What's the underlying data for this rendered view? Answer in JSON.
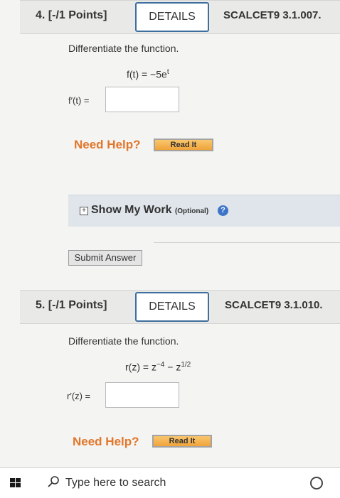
{
  "q4": {
    "number": "4. [-/1 Points]",
    "details_label": "DETAILS",
    "code": "SCALCET9 3.1.007.",
    "instruction": "Differentiate the function.",
    "func_lhs": "f(t) = −5e",
    "func_exp": "t",
    "answer_label": "f′(t) =",
    "answer_value": "",
    "need_help": "Need Help?",
    "read_it": "Read It"
  },
  "show_work": {
    "label": "Show My Work",
    "optional": "(Optional)"
  },
  "submit_label": "Submit Answer",
  "q5": {
    "number": "5. [-/1 Points]",
    "details_label": "DETAILS",
    "code": "SCALCET9 3.1.010.",
    "instruction": "Differentiate the function.",
    "func_base1": "r(z) = z",
    "func_exp1": "−4",
    "func_mid": " − z",
    "func_exp2": "1/2",
    "answer_label": "r′(z) =",
    "answer_value": "",
    "need_help": "Need Help?",
    "read_it": "Read It"
  },
  "taskbar": {
    "search_placeholder": "Type here to search"
  }
}
